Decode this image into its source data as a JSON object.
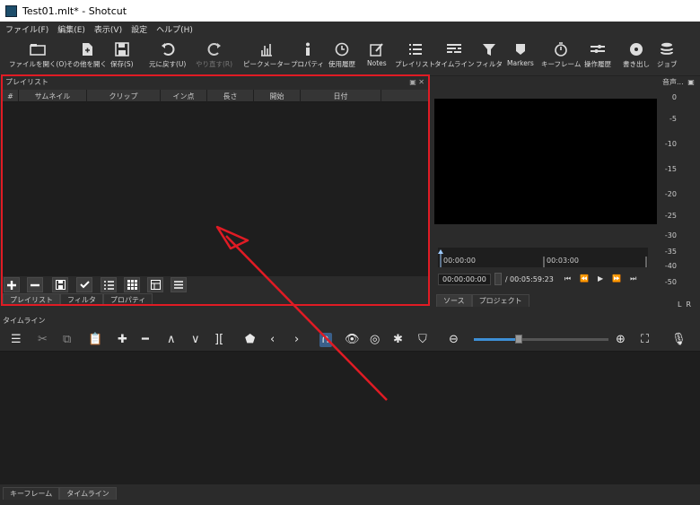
{
  "window": {
    "title": "Test01.mlt* - Shotcut"
  },
  "menu": [
    "ファイル(F)",
    "編集(E)",
    "表示(V)",
    "設定",
    "ヘルプ(H)"
  ],
  "toolbar": [
    {
      "label": "ファイルを開く(O)",
      "icon": "folder-icon"
    },
    {
      "label": "その他を開く",
      "icon": "open-other-icon"
    },
    {
      "label": "保存(S)",
      "icon": "save-icon"
    },
    {
      "label": "元に戻す(U)",
      "icon": "undo-icon"
    },
    {
      "label": "やり直す(R)",
      "icon": "redo-icon"
    },
    {
      "label": "ピークメーター",
      "icon": "peak-meter-icon"
    },
    {
      "label": "プロパティ",
      "icon": "info-icon"
    },
    {
      "label": "使用履歴",
      "icon": "clock-icon"
    },
    {
      "label": "Notes",
      "icon": "notes-icon"
    },
    {
      "label": "プレイリスト",
      "icon": "list-icon"
    },
    {
      "label": "タイムライン",
      "icon": "timeline-icon"
    },
    {
      "label": "フィルタ",
      "icon": "filter-icon"
    },
    {
      "label": "Markers",
      "icon": "marker-icon"
    },
    {
      "label": "キーフレーム",
      "icon": "stopwatch-icon"
    },
    {
      "label": "操作履歴",
      "icon": "history-icon"
    },
    {
      "label": "書き出し",
      "icon": "export-disc-icon"
    },
    {
      "label": "ジョブ",
      "icon": "jobs-stack-icon"
    }
  ],
  "playlist": {
    "title": "プレイリスト",
    "columns": [
      "#",
      "サムネイル",
      "クリップ",
      "イン点",
      "長さ",
      "開始",
      "日付"
    ],
    "tabs": [
      "プレイリスト",
      "フィルタ",
      "プロパティ"
    ]
  },
  "player": {
    "scrub_ticks": [
      "00:00:00",
      "00:03:00"
    ],
    "timecode": "00:00:00:00",
    "duration": "/ 00:05:59:23",
    "tabs": [
      "ソース",
      "プロジェクト"
    ]
  },
  "audio_meter": {
    "title": "音声...",
    "levels": [
      "0",
      "-5",
      "-10",
      "-15",
      "-20",
      "-25",
      "-30",
      "-35",
      "-40",
      "-50"
    ],
    "channels": "LR"
  },
  "timeline": {
    "title": "タイムライン",
    "zoom_fraction": 0.33
  },
  "bottom_tabs": [
    "キーフレーム",
    "タイムライン"
  ]
}
